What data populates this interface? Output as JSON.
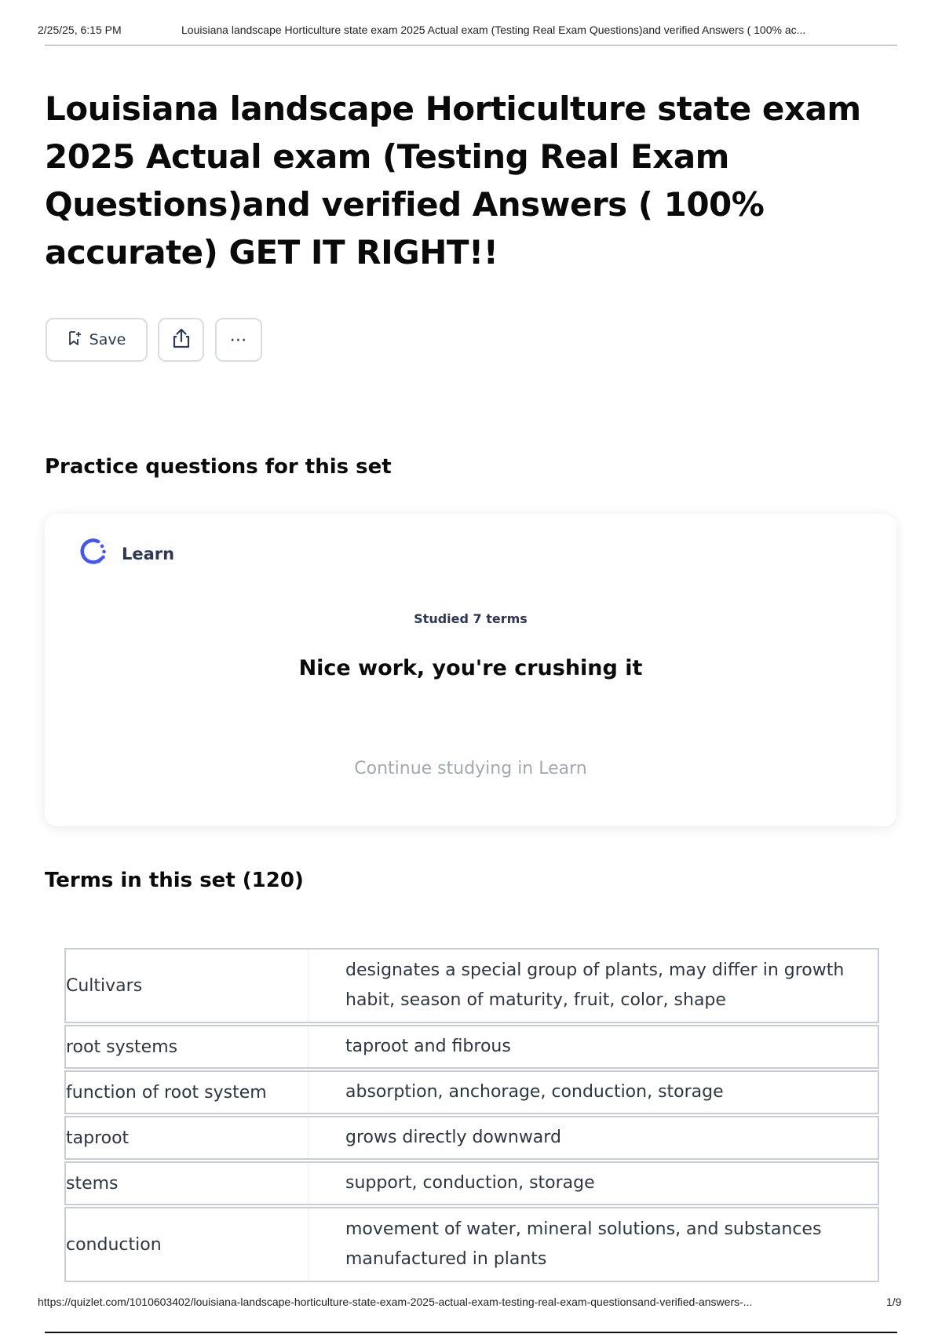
{
  "print_header": {
    "date": "2/25/25, 6:15 PM",
    "title": "Louisiana landscape Horticulture state exam 2025 Actual exam (Testing Real Exam Questions)and verified Answers ( 100% ac..."
  },
  "page_title": "Louisiana landscape Horticulture state exam 2025 Actual exam (Testing Real Exam Questions)and verified Answers ( 100% accurate) GET IT RIGHT!!",
  "actions": {
    "save_label": "Save",
    "save_icon": "bookmark-add-icon",
    "share_icon": "share-icon",
    "more_icon": "more-icon",
    "more_glyph": "⋯"
  },
  "practice": {
    "heading": "Practice questions for this set",
    "mode_label": "Learn",
    "mode_icon": "learn-icon",
    "studied_text": "Studied 7 terms",
    "message": "Nice work, you're crushing it",
    "continue_label": "Continue studying in Learn"
  },
  "terms": {
    "heading": "Terms in this set (120)",
    "rows": [
      {
        "term": "Cultivars",
        "definition": "designates a special group of plants, may differ in growth habit, season of maturity, fruit, color, shape"
      },
      {
        "term": "root systems",
        "definition": "taproot and fibrous"
      },
      {
        "term": "function of root system",
        "definition": "absorption, anchorage, conduction, storage"
      },
      {
        "term": "taproot",
        "definition": "grows directly downward"
      },
      {
        "term": "stems",
        "definition": "support, conduction, storage"
      },
      {
        "term": "conduction",
        "definition": "movement of water, mineral solutions, and substances manufactured in plants"
      }
    ]
  },
  "footer": {
    "url": "https://quizlet.com/1010603402/louisiana-landscape-horticulture-state-exam-2025-actual-exam-testing-real-exam-questionsand-verified-answers-...",
    "page": "1/9"
  },
  "colors": {
    "accent_learn": "#4255ff",
    "text_muted": "#a4a8b4",
    "text_dark": "#2e3856"
  }
}
